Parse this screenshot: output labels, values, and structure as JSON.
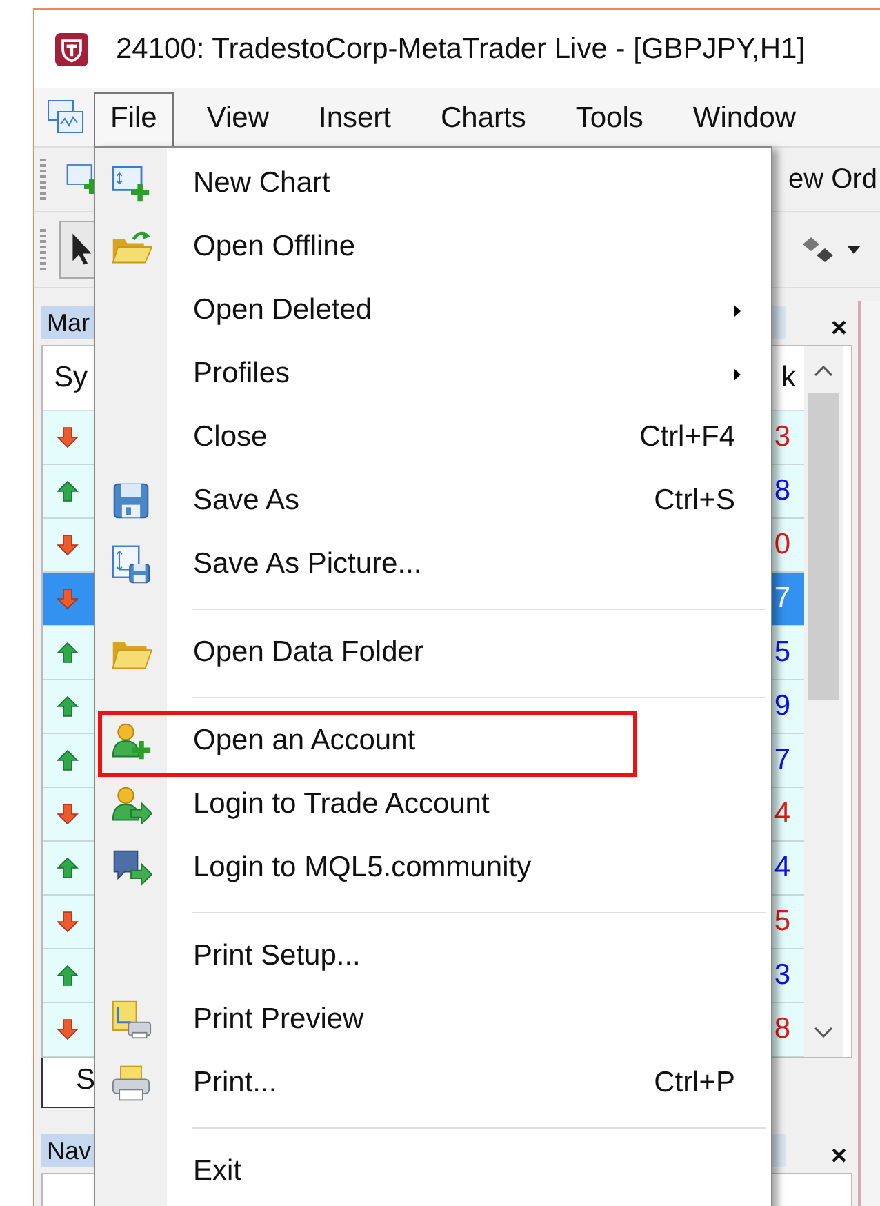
{
  "window": {
    "title": "24100: TradestoCorp-MetaTrader Live - [GBPJPY,H1]"
  },
  "menu_bar": [
    {
      "label": "File",
      "selected": true
    },
    {
      "label": "View",
      "selected": false
    },
    {
      "label": "Insert",
      "selected": false
    },
    {
      "label": "Charts",
      "selected": false
    },
    {
      "label": "Tools",
      "selected": false
    },
    {
      "label": "Window",
      "selected": false
    }
  ],
  "toolbar": {
    "button_text": "ew Ord"
  },
  "file_menu": [
    {
      "kind": "item",
      "label": "New Chart",
      "submenu": false,
      "highlighted": false
    },
    {
      "kind": "item",
      "label": "Open Offline",
      "submenu": false,
      "highlighted": false
    },
    {
      "kind": "item",
      "label": "Open Deleted",
      "submenu": true,
      "highlighted": false
    },
    {
      "kind": "item",
      "label": "Profiles",
      "submenu": true,
      "highlighted": false
    },
    {
      "kind": "item",
      "label": "Close",
      "shortcut": "Ctrl+F4",
      "submenu": false,
      "highlighted": false
    },
    {
      "kind": "item",
      "label": "Save As",
      "shortcut": "Ctrl+S",
      "submenu": false,
      "highlighted": false
    },
    {
      "kind": "item",
      "label": "Save As Picture...",
      "submenu": false,
      "highlighted": false
    },
    {
      "kind": "separator"
    },
    {
      "kind": "item",
      "label": "Open Data Folder",
      "submenu": false,
      "highlighted": false
    },
    {
      "kind": "separator"
    },
    {
      "kind": "item",
      "label": "Open an Account",
      "submenu": false,
      "highlighted": true
    },
    {
      "kind": "item",
      "label": "Login to Trade Account",
      "submenu": false,
      "highlighted": false
    },
    {
      "kind": "item",
      "label": "Login to MQL5.community",
      "submenu": false,
      "highlighted": false
    },
    {
      "kind": "separator"
    },
    {
      "kind": "item",
      "label": "Print Setup...",
      "submenu": false,
      "highlighted": false
    },
    {
      "kind": "item",
      "label": "Print Preview",
      "submenu": false,
      "highlighted": false
    },
    {
      "kind": "item",
      "label": "Print...",
      "shortcut": "Ctrl+P",
      "submenu": false,
      "highlighted": false
    },
    {
      "kind": "separator"
    },
    {
      "kind": "item",
      "label": "Exit",
      "submenu": false,
      "highlighted": false
    }
  ],
  "market_watch": {
    "title": "Mar",
    "close": "×",
    "columns": [
      "Sy",
      "k"
    ],
    "tab": "S",
    "rows": [
      {
        "kind": "down",
        "value": "3",
        "selected": false
      },
      {
        "kind": "up",
        "value": "8",
        "selected": false
      },
      {
        "kind": "down",
        "value": "0",
        "selected": false
      },
      {
        "kind": "down",
        "value": "7",
        "selected": true
      },
      {
        "kind": "up",
        "value": "5",
        "selected": false
      },
      {
        "kind": "up",
        "value": "9",
        "selected": false
      },
      {
        "kind": "up",
        "value": "7",
        "selected": false
      },
      {
        "kind": "down",
        "value": "4",
        "selected": false
      },
      {
        "kind": "up",
        "value": "4",
        "selected": false
      },
      {
        "kind": "down",
        "value": "5",
        "selected": false
      },
      {
        "kind": "up",
        "value": "3",
        "selected": false
      },
      {
        "kind": "down",
        "value": "8",
        "selected": false
      }
    ]
  },
  "navigator": {
    "title": "Nav",
    "close": "×"
  }
}
